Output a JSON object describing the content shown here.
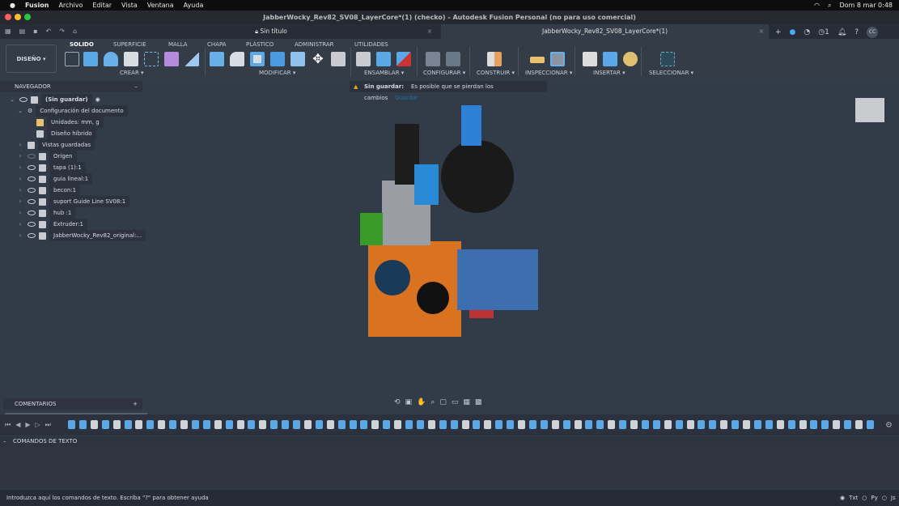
{
  "menubar": {
    "app": "Fusion",
    "items": [
      "Archivo",
      "Editar",
      "Vista",
      "Ventana",
      "Ayuda"
    ],
    "clock": "Dom 8 mar  0:48"
  },
  "window": {
    "title": "JabberWocky_Rev82_SV08_LayerCore*(1) (checko) - Autodesk Fusion Personal (no para uso comercial)"
  },
  "tabs": [
    {
      "label": "Sin título"
    },
    {
      "label": "JabberWocky_Rev82_SV08_LayerCore*(1)"
    }
  ],
  "header": {
    "jobs_count": "1",
    "user_initials": "CC"
  },
  "toolbar": {
    "workspace": "DISEÑO ▾",
    "tabs": [
      "SOLIDO",
      "SUPERFICIE",
      "MALLA",
      "CHAPA",
      "PLÁSTICO",
      "ADMINISTRAR",
      "UTILIDADES"
    ],
    "groups": [
      "CREAR ▾",
      "MODIFICAR ▾",
      "ENSAMBLAR ▾",
      "CONFIGURAR ▾",
      "CONSTRUIR ▾",
      "INSPECCIONAR ▾",
      "INSERTAR ▾",
      "SELECCIONAR ▾"
    ]
  },
  "navigator": {
    "title": "NAVEGADOR",
    "root": "(Sin guardar)",
    "doc_settings": "Configuración del documento",
    "units": "Unidades: mm, g",
    "hybrid": "Diseño híbrido",
    "saved_views": "Vistas guardadas",
    "items": [
      "Origen",
      "tapa (1):1",
      "guia lineal:1",
      "becon:1",
      "suport  Guide Line SV08:1",
      "hub :1",
      "Extruder:1",
      "JabberWocky_Rev82_original:..."
    ]
  },
  "banner": {
    "title": "Sin guardar:",
    "message": "Es posible que se pierdan los cambios",
    "action": "Guardar"
  },
  "comments": {
    "title": "COMENTARIOS",
    "add": "+"
  },
  "text_commands": {
    "title": "COMANDOS DE TEXTO",
    "placeholder": "Introduzca aquí los comandos de texto. Escriba \"?\" para obtener ayuda",
    "modes": [
      "Txt",
      "Py",
      "Js"
    ],
    "selected_mode": "Txt"
  },
  "timeline": {
    "features": [
      "sketch",
      "sketch",
      "body",
      "sketch",
      "body",
      "sketch",
      "body",
      "sketch",
      "body",
      "sketch",
      "body",
      "sketch",
      "sketch",
      "body",
      "sketch",
      "body",
      "sketch",
      "body",
      "sketch",
      "sketch",
      "sketch",
      "body",
      "sketch",
      "body",
      "sketch",
      "sketch",
      "sketch",
      "body",
      "sketch",
      "body",
      "sketch",
      "sketch",
      "body",
      "sketch",
      "sketch",
      "body",
      "sketch",
      "body",
      "sketch",
      "sketch",
      "body",
      "sketch",
      "sketch",
      "body",
      "sketch",
      "body",
      "sketch",
      "sketch",
      "body",
      "sketch",
      "body",
      "sketch",
      "sketch",
      "body",
      "sketch",
      "body",
      "sketch",
      "sketch",
      "body",
      "sketch",
      "body",
      "sketch",
      "sketch",
      "body",
      "sketch",
      "body",
      "sketch",
      "sketch",
      "body",
      "sketch",
      "body",
      "sketch"
    ]
  },
  "colors": {
    "accent": "#1e90d8",
    "canvas": "#323b48",
    "warning": "#f0a020"
  }
}
